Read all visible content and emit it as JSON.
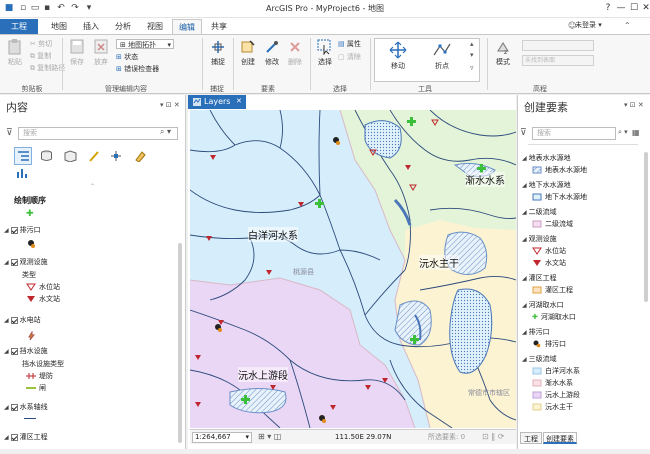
{
  "window": {
    "title": "ArcGIS Pro - MyProject6 - 地图",
    "min": "—",
    "max": "☐",
    "close": "✕"
  },
  "tabs": {
    "file": "工程",
    "map": "地图",
    "insert": "插入",
    "analysis": "分析",
    "view": "视图",
    "edit": "编辑",
    "share": "共享"
  },
  "signin": "未登录 ▾",
  "ribbon": {
    "clipboard": {
      "paste": "粘贴",
      "cut": "剪切",
      "copy": "复制",
      "copy_path": "复制路径",
      "label": "剪贴板"
    },
    "manage": {
      "save": "保存",
      "discard": "放弃",
      "snapping_tool": "地图拓扑",
      "status": "状态",
      "error_inspector": "错误检查器",
      "label": "管理编辑内容"
    },
    "snapping": {
      "snap": "捕捉",
      "label": "捕捉"
    },
    "features": {
      "create": "创建",
      "modify": "修改",
      "delete": "删除",
      "label": "要素"
    },
    "selection": {
      "select": "选择",
      "attributes": "属性",
      "clear": "清除",
      "label": "选择"
    },
    "tools": {
      "move": "移动",
      "vertices": "折点",
      "label": "工具"
    },
    "elements": {
      "mode": "模式",
      "label": "高程",
      "placeholder": "未找到表面"
    }
  },
  "contents": {
    "title": "内容",
    "search_placeholder": "搜索",
    "section": "绘制顺序",
    "rows": [
      "排污口",
      "观测设施",
      "类型",
      "水位站",
      "水文站",
      "水电站",
      "挡水设施",
      "挡水设施类型",
      "堤防",
      "闸",
      "水系轴线",
      "灌区工程"
    ]
  },
  "map": {
    "tab": "Layers",
    "labels": {
      "baiyang": "白洋河水系",
      "jianshui": "渐水水系",
      "yuanshui_main": "沅水主干",
      "yuanshui_up": "沅水上游段",
      "taoyuan": "桃源县",
      "changde": "常德市市辖区"
    },
    "scale": "1:264,667",
    "coords": "111.50E 29.07N",
    "selected": "所选要素: 0"
  },
  "create": {
    "title": "创建要素",
    "search_placeholder": "搜索",
    "rows": [
      "地表水水源地",
      "地表水水源地",
      "地下水水源地",
      "地下水水源地",
      "二级流域",
      "二级流域",
      "观测设施",
      "水位站",
      "水文站",
      "灌区工程",
      "灌区工程",
      "河湖取水口",
      "河湖取水口",
      "排污口",
      "排污口",
      "三级流域",
      "白洋河水系",
      "渐水水系",
      "沅水上游段",
      "沅水主干"
    ]
  },
  "bottom_tabs": {
    "catalog": "工程",
    "create": "创建要素"
  },
  "colors": {
    "accent": "#2a6fba",
    "water": "#d6eefb",
    "purple": "#ead7f5",
    "green": "#e4f4d8",
    "yellow": "#fbf3d2",
    "river": "#2c4a7c",
    "station": "#c0262d"
  }
}
